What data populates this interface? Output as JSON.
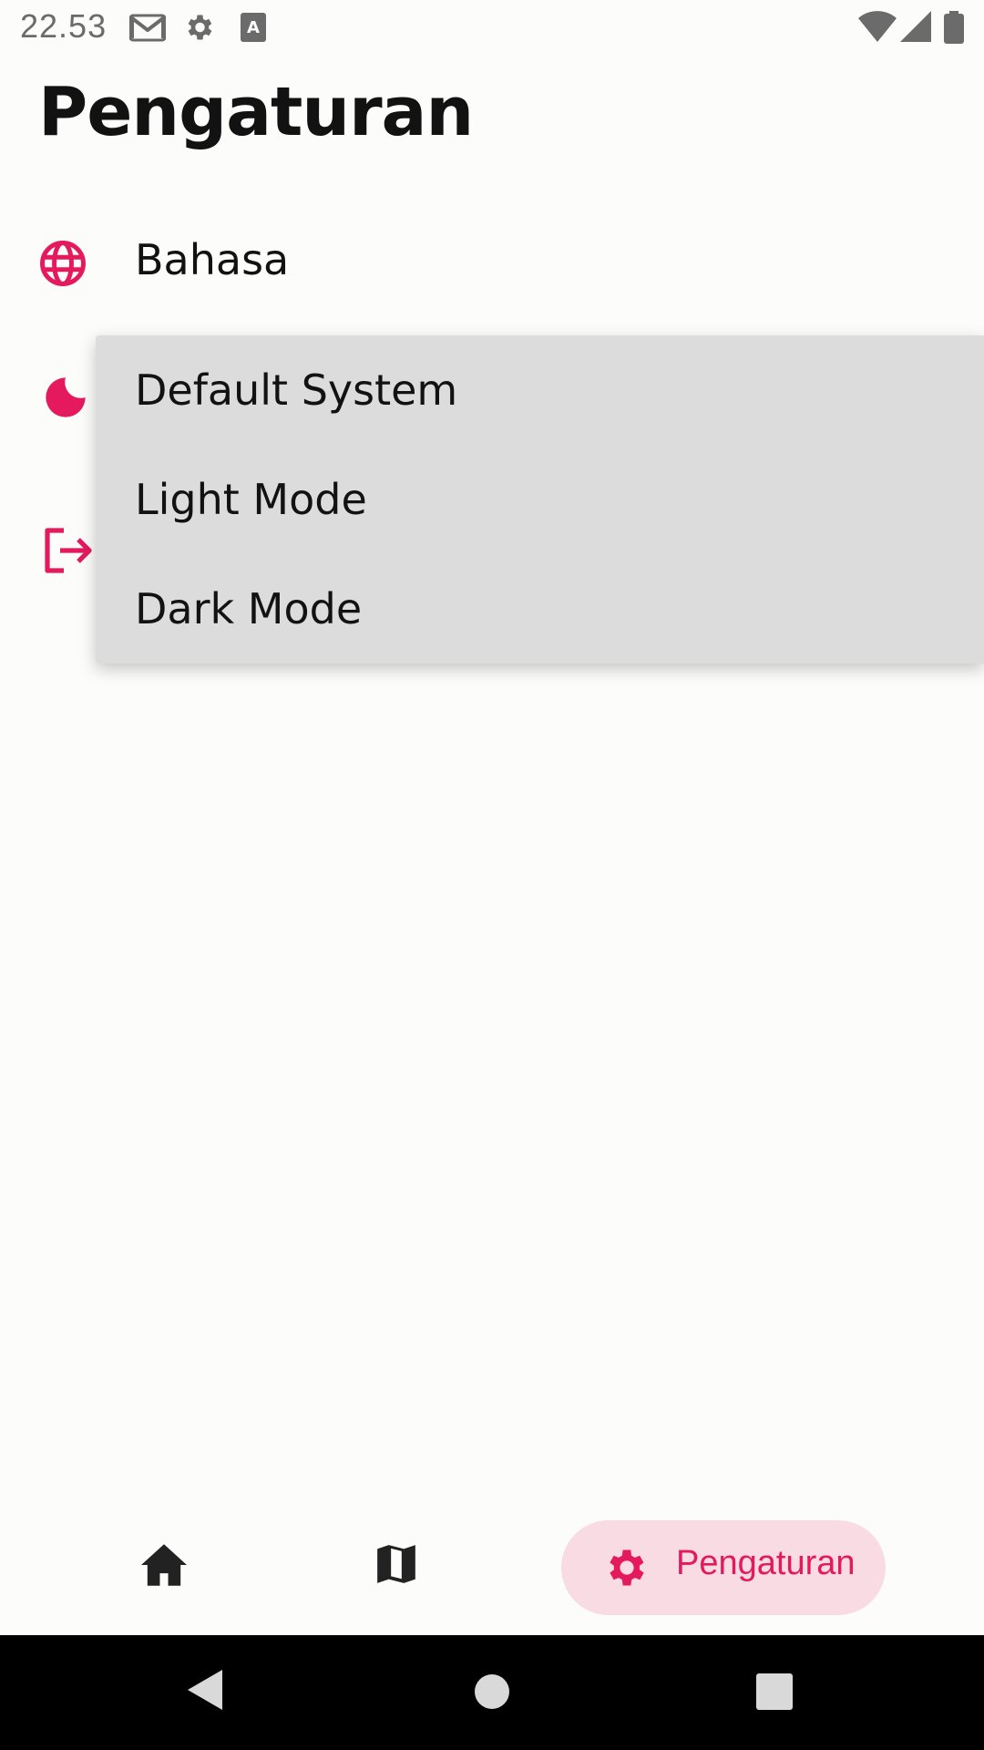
{
  "status_bar": {
    "time": "22.53",
    "icons": [
      "gmail-icon",
      "settings-icon",
      "font-icon",
      "wifi-icon",
      "signal-icon",
      "battery-icon"
    ]
  },
  "page": {
    "title": "Pengaturan"
  },
  "settings": {
    "language_label": "Bahasa",
    "language_icon": "globe-icon",
    "theme_icon": "moon-icon",
    "logout_icon": "logout-icon"
  },
  "theme_menu": {
    "options": [
      "Default System",
      "Light Mode",
      "Dark Mode"
    ]
  },
  "bottom_nav": {
    "items": [
      {
        "icon": "home-icon"
      },
      {
        "icon": "map-icon"
      },
      {
        "icon": "gear-icon",
        "label": "Pengaturan",
        "active": true
      }
    ]
  },
  "colors": {
    "accent": "#e5195e",
    "active_pill": "#f8dbe3",
    "menu_bg": "#dddcdc",
    "background": "#fcfcfb"
  }
}
